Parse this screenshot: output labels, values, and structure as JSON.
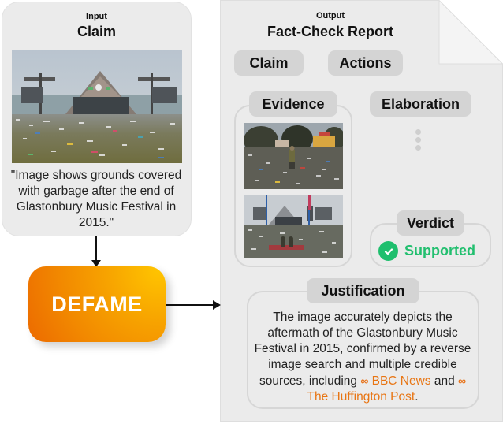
{
  "input": {
    "small_title": "Input",
    "title": "Claim",
    "image_description": "Glastonbury pyramid stage with field covered in garbage",
    "claim_text": "\"Image shows grounds covered with garbage after the end of Glastonbury Music Festival in 2015.\""
  },
  "system": {
    "name": "DEFAME"
  },
  "output": {
    "small_title": "Output",
    "title": "Fact-Check Report",
    "sections": {
      "claim": "Claim",
      "actions": "Actions",
      "evidence": "Evidence",
      "elaboration": "Elaboration",
      "verdict": "Verdict",
      "justification": "Justification"
    },
    "evidence_images": [
      "Person standing in littered festival field",
      "Pyramid stage with two people sitting amid litter"
    ],
    "verdict": {
      "label": "Supported",
      "icon": "check-circle-icon",
      "color": "#22bf6f"
    },
    "justification": {
      "text_before": "The image accurately depicts the aftermath of the Glastonbury Music Festival in 2015, confirmed by a reverse image search and multiple credible sources, including ",
      "link1": "BBC News",
      "text_middle": " and ",
      "link2": "The Huffington Post",
      "text_after": ".",
      "link_icon": "link-icon",
      "link_color": "#e87513"
    }
  }
}
